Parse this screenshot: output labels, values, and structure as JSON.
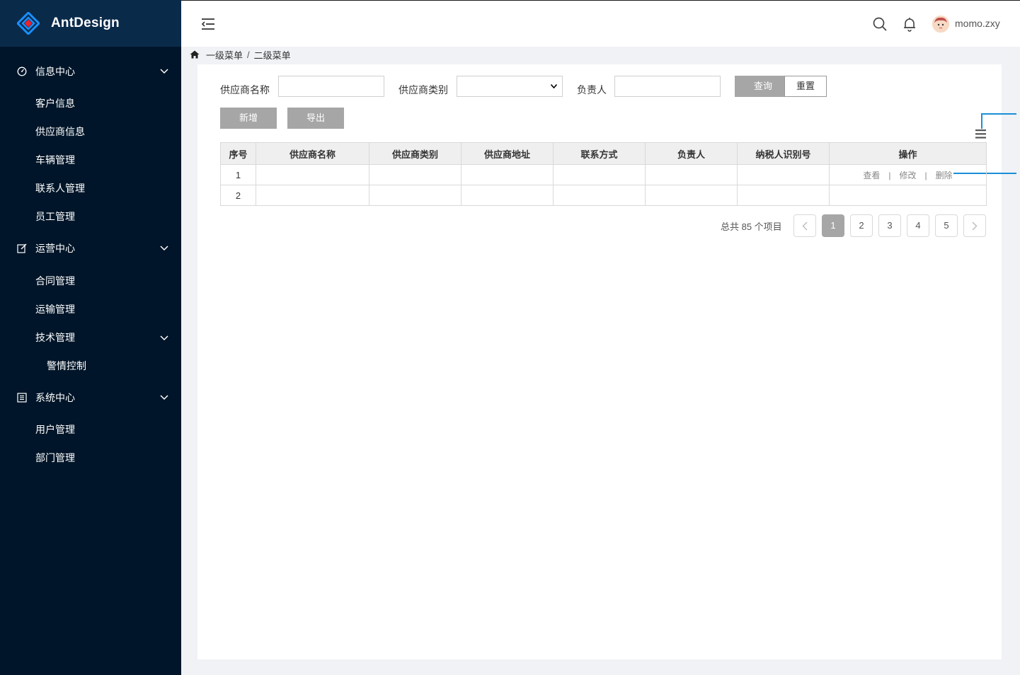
{
  "app": {
    "logo_text": "AntDesign",
    "user_name": "momo.zxy"
  },
  "sidebar": {
    "groups": [
      {
        "label": "信息中心",
        "icon": "dashboard-icon",
        "items": [
          "客户信息",
          "供应商信息",
          "车辆管理",
          "联系人管理",
          "员工管理"
        ]
      },
      {
        "label": "运营中心",
        "icon": "edit-icon",
        "items": [
          "合同管理",
          "运输管理"
        ],
        "submenu": {
          "label": "技术管理",
          "items": [
            "警情控制"
          ]
        }
      },
      {
        "label": "系统中心",
        "icon": "list-icon",
        "items": [
          "用户管理",
          "部门管理"
        ]
      }
    ]
  },
  "breadcrumb": {
    "level1": "一级菜单",
    "separator": "/",
    "level2": "二级菜单"
  },
  "filters": {
    "supplier_name_label": "供应商名称",
    "supplier_name_value": "",
    "supplier_type_label": "供应商类别",
    "supplier_type_value": "",
    "owner_label": "负责人",
    "owner_value": "",
    "query_button": "查询",
    "reset_button": "重置"
  },
  "actions": {
    "add_button": "新增",
    "export_button": "导出"
  },
  "table": {
    "columns": [
      "序号",
      "供应商名称",
      "供应商类别",
      "供应商地址",
      "联系方式",
      "负责人",
      "纳税人识别号",
      "操作"
    ],
    "rows": [
      {
        "index": "1",
        "name": "",
        "type": "",
        "address": "",
        "contact": "",
        "owner": "",
        "tax_id": "",
        "ops": [
          "查看",
          "修改",
          "删除"
        ]
      },
      {
        "index": "2",
        "name": "",
        "type": "",
        "address": "",
        "contact": "",
        "owner": "",
        "tax_id": "",
        "ops": []
      }
    ],
    "op_separator": "|"
  },
  "pagination": {
    "total_text": "总共 85 个项目",
    "pages": [
      "1",
      "2",
      "3",
      "4",
      "5"
    ],
    "current": "1"
  },
  "colors": {
    "sidebar_bg": "#001529",
    "logo_bg": "#0a2a4a",
    "gray_button": "#a6a6a6",
    "annotation_line": "#1a8fd8"
  }
}
